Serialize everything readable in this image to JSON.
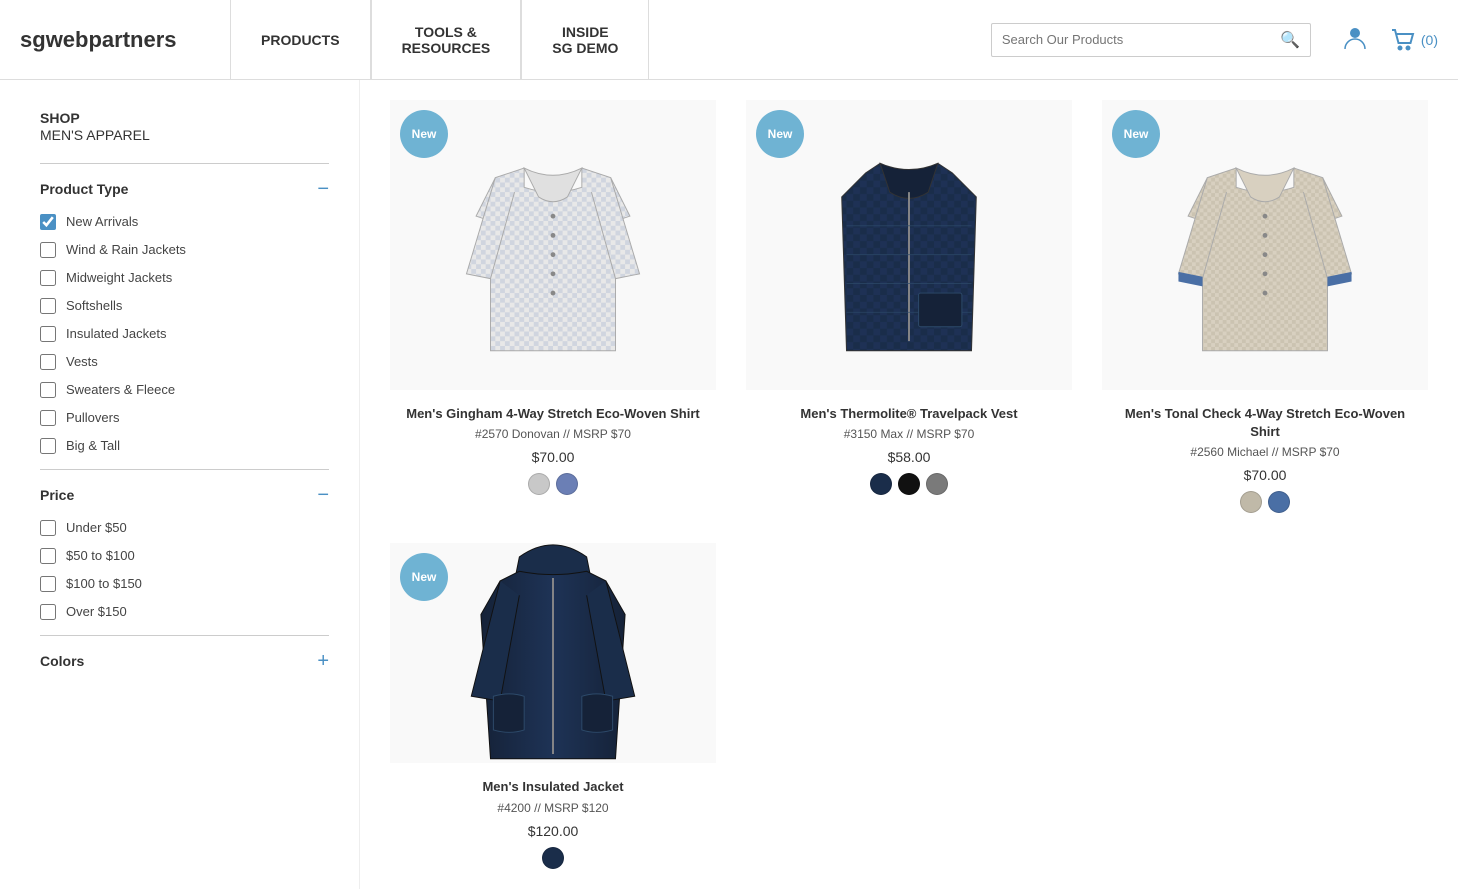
{
  "header": {
    "logo_bold": "sg",
    "logo_regular": "webpartners",
    "nav_items": [
      {
        "id": "products",
        "label": "PRODUCTS"
      },
      {
        "id": "tools",
        "label": "TOOLS &\nRESOURCES"
      },
      {
        "id": "inside",
        "label": "INSIDE\nSG DEMO"
      }
    ],
    "search_placeholder": "Search Our Products",
    "cart_count": "(0)",
    "cart_label": "(0)"
  },
  "sidebar": {
    "shop_label": "SHOP",
    "category_label": "MEN'S APPAREL",
    "product_type_label": "Product Type",
    "product_type_collapse": "−",
    "filters": [
      {
        "id": "new-arrivals",
        "label": "New Arrivals",
        "checked": true
      },
      {
        "id": "wind-rain",
        "label": "Wind & Rain Jackets",
        "checked": false
      },
      {
        "id": "midweight",
        "label": "Midweight Jackets",
        "checked": false
      },
      {
        "id": "softshells",
        "label": "Softshells",
        "checked": false
      },
      {
        "id": "insulated",
        "label": "Insulated Jackets",
        "checked": false
      },
      {
        "id": "vests",
        "label": "Vests",
        "checked": false
      },
      {
        "id": "sweaters",
        "label": "Sweaters & Fleece",
        "checked": false
      },
      {
        "id": "pullovers",
        "label": "Pullovers",
        "checked": false
      },
      {
        "id": "big-tall",
        "label": "Big & Tall",
        "checked": false
      }
    ],
    "price_label": "Price",
    "price_collapse": "−",
    "price_filters": [
      {
        "id": "under50",
        "label": "Under $50",
        "checked": false
      },
      {
        "id": "50to100",
        "label": "$50 to $100",
        "checked": false
      },
      {
        "id": "100to150",
        "label": "$100 to $150",
        "checked": false
      },
      {
        "id": "over150",
        "label": "Over $150",
        "checked": false
      }
    ],
    "colors_label": "Colors",
    "colors_expand": "+"
  },
  "products": [
    {
      "id": "p1",
      "badge": "New",
      "name": "Men's Gingham 4-Way Stretch Eco-Woven Shirt",
      "sku": "#2570 Donovan // MSRP $70",
      "price": "$70.00",
      "type": "shirt",
      "colors": [
        "#c8c8c8",
        "#6b7fb5"
      ]
    },
    {
      "id": "p2",
      "badge": "New",
      "name": "Men's Thermolite® Travelpack Vest",
      "sku": "#3150 Max // MSRP $70",
      "price": "$58.00",
      "type": "vest",
      "colors": [
        "#1a2d4a",
        "#111111",
        "#7a7a7a"
      ]
    },
    {
      "id": "p3",
      "badge": "New",
      "name": "Men's Tonal Check 4-Way Stretch Eco-Woven Shirt",
      "sku": "#2560 Michael // MSRP $70",
      "price": "$70.00",
      "type": "shirt2",
      "colors": [
        "#c0b9a8",
        "#4a6fa5"
      ]
    },
    {
      "id": "p4",
      "badge": "New",
      "name": "Men's Insulated Jacket",
      "sku": "#4200 // MSRP $120",
      "price": "$120.00",
      "type": "jacket",
      "colors": [
        "#1a2d4a"
      ]
    }
  ],
  "accent_color": "#4a90c4",
  "badge_color": "#6fb3d3"
}
